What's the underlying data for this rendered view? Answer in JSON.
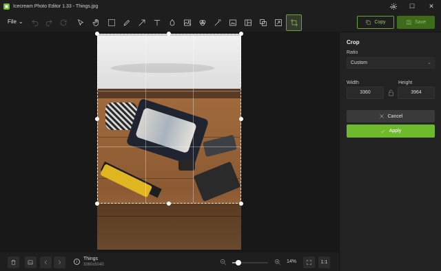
{
  "window": {
    "title": "Icecream Photo Editor 1.33 - Things.jpg",
    "minimize": "—",
    "maximize": "☐",
    "close": "✕"
  },
  "toolbar": {
    "file_label": "File",
    "tools": [
      {
        "name": "undo-icon",
        "enabled": false
      },
      {
        "name": "redo-icon",
        "enabled": false
      },
      {
        "name": "reset-icon",
        "enabled": false
      },
      {
        "name": "select-pointer-icon",
        "enabled": true
      },
      {
        "name": "hand-pan-icon",
        "enabled": true
      },
      {
        "name": "marquee-select-icon",
        "enabled": true
      },
      {
        "name": "pencil-icon",
        "enabled": true
      },
      {
        "name": "arrow-icon",
        "enabled": true
      },
      {
        "name": "text-icon",
        "enabled": true
      },
      {
        "name": "drop-icon",
        "enabled": true
      },
      {
        "name": "image-adjust-icon",
        "enabled": true
      },
      {
        "name": "filters-icon",
        "enabled": true
      },
      {
        "name": "magic-wand-icon",
        "enabled": true
      },
      {
        "name": "insert-image-icon",
        "enabled": true
      },
      {
        "name": "split-panel-icon",
        "enabled": true
      },
      {
        "name": "layers-icon",
        "enabled": true
      },
      {
        "name": "resize-icon",
        "enabled": true
      },
      {
        "name": "crop-icon",
        "enabled": true,
        "active": true
      }
    ],
    "copy_label": "Copy",
    "save_label": "Save"
  },
  "crop_panel": {
    "title": "Crop",
    "ratio_label": "Ratio",
    "ratio_value": "Custom",
    "width_label": "Width",
    "height_label": "Height",
    "width_value": "3360",
    "height_value": "3964",
    "cancel_label": "Cancel",
    "apply_label": "Apply"
  },
  "bottom": {
    "file_name": "Things",
    "file_dims": "3360x5040",
    "zoom_value": "14%",
    "zoom_level": 0.18,
    "actual_size_label": "1:1"
  },
  "colors": {
    "accent": "#6fba2c",
    "background": "#1b1b1b",
    "panel": "#222222"
  }
}
